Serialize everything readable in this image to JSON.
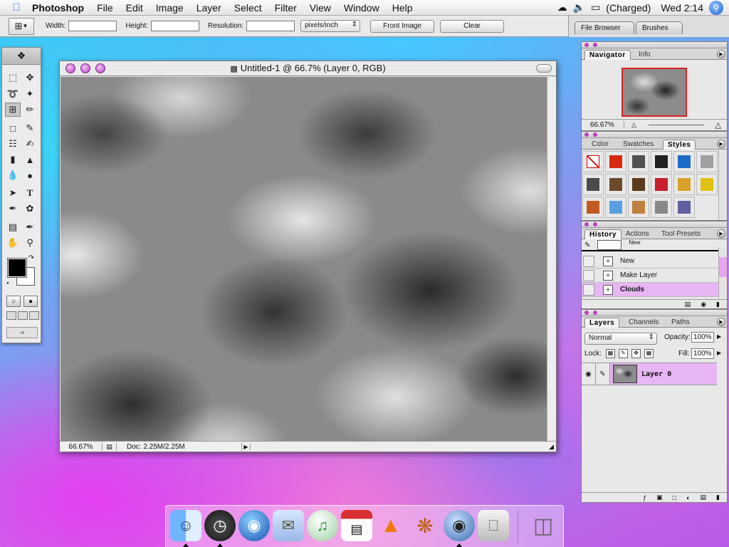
{
  "menubar": {
    "app": "Photoshop",
    "menus": [
      "File",
      "Edit",
      "Image",
      "Layer",
      "Select",
      "Filter",
      "View",
      "Window",
      "Help"
    ],
    "battery": "(Charged)",
    "clock": "Wed 2:14"
  },
  "options": {
    "width_label": "Width:",
    "height_label": "Height:",
    "resolution_label": "Resolution:",
    "units": "pixels/inch",
    "front_image": "Front Image",
    "clear": "Clear",
    "wells": [
      "File Browser",
      "Brushes"
    ]
  },
  "document": {
    "title": "Untitled-1 @ 66.7% (Layer 0, RGB)",
    "zoom": "66.67%",
    "doc_size": "Doc: 2.25M/2.25M"
  },
  "navigator": {
    "tabs": [
      "Navigator",
      "Info"
    ],
    "zoom": "66.67%"
  },
  "styles_palette": {
    "tabs": [
      "Color",
      "Swatches",
      "Styles"
    ],
    "swatch_colors": [
      "#ffffff",
      "#d82a10",
      "#505050",
      "#202020",
      "#1c6cc8",
      "#a0a0a0",
      "#4a4a4a",
      "#6a4a2a",
      "#5a3a1a",
      "#c8202a",
      "#d8a028",
      "#e0c010",
      "#c05a20",
      "#5aa0e0",
      "#c08040",
      "#888888",
      "#6060a0"
    ]
  },
  "history": {
    "tabs": [
      "History",
      "Actions",
      "Tool Presets"
    ],
    "snapshot_label": "New",
    "items": [
      "New",
      "Make Layer",
      "Clouds"
    ]
  },
  "layers": {
    "tabs": [
      "Layers",
      "Channels",
      "Paths"
    ],
    "blend_mode": "Normal",
    "opacity_label": "Opacity:",
    "opacity": "100%",
    "lock_label": "Lock:",
    "fill_label": "Fill:",
    "fill": "100%",
    "layer_name": "Layer 0"
  },
  "colors": {
    "highlight": "#e8b6f4",
    "accent": "#c040c0"
  }
}
